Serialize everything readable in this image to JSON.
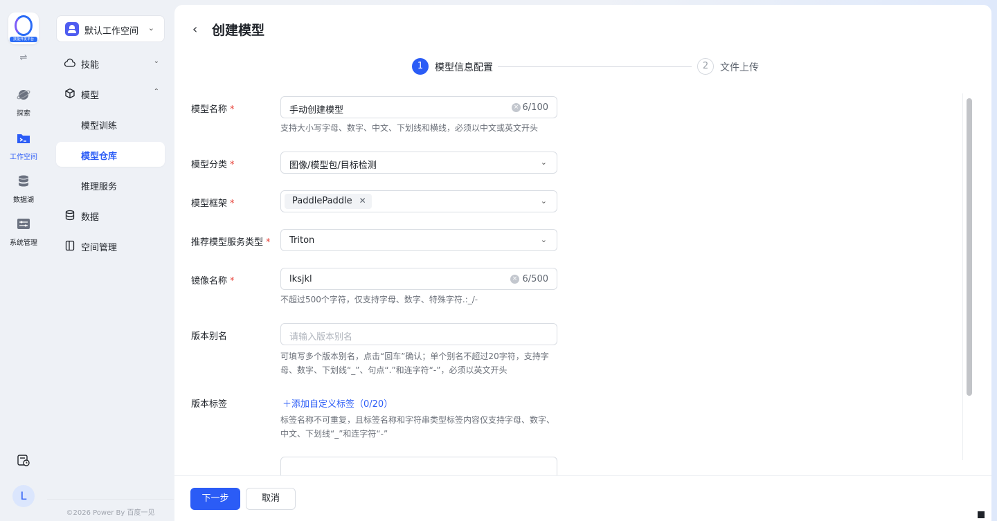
{
  "rail": {
    "logo_caption": "技能开发平台",
    "items": [
      {
        "label": "探索",
        "icon": "planet-icon"
      },
      {
        "label": "工作空间",
        "icon": "terminal-folder-icon"
      },
      {
        "label": "数据湖",
        "icon": "database-icon"
      },
      {
        "label": "系统管理",
        "icon": "server-settings-icon"
      }
    ],
    "avatar": "L"
  },
  "sidebar": {
    "workspace": "默认工作空间",
    "items": [
      {
        "label": "技能"
      },
      {
        "label": "模型"
      },
      {
        "label": "模型训练"
      },
      {
        "label": "模型仓库"
      },
      {
        "label": "推理服务"
      },
      {
        "label": "数据"
      },
      {
        "label": "空间管理"
      }
    ],
    "copyright": "©2026 Power By 百度一见"
  },
  "page": {
    "title": "创建模型",
    "steps": [
      {
        "num": "1",
        "label": "模型信息配置"
      },
      {
        "num": "2",
        "label": "文件上传"
      }
    ]
  },
  "form": {
    "name": {
      "label": "模型名称",
      "value": "手动创建模型",
      "count": "6/100",
      "hint": "支持大小写字母、数字、中文、下划线和横线，必须以中文或英文开头"
    },
    "category": {
      "label": "模型分类",
      "value": "图像/模型包/目标检测"
    },
    "framework": {
      "label": "模型框架",
      "tag": "PaddlePaddle"
    },
    "service_type": {
      "label": "推荐模型服务类型",
      "value": "Triton"
    },
    "image": {
      "label": "镜像名称",
      "value": "lksjkl",
      "count": "6/500",
      "hint": "不超过500个字符，仅支持字母、数字、特殊字符.:_/-"
    },
    "alias": {
      "label": "版本别名",
      "placeholder": "请输入版本别名",
      "hint1": "可填写多个版本别名，点击“回车”确认；单个别名不超过20字符，支持字",
      "hint2": "母、数字、下划线“_”、句点“.”和连字符“-”，必须以英文开头"
    },
    "tags": {
      "label": "版本标签",
      "add": "＋添加自定义标签（0/20）",
      "hint1": "标签名称不可重复，且标签名称和字符串类型标签内容仅支持字母、数字、",
      "hint2": "中文、下划线“_”和连字符“-”"
    }
  },
  "footer": {
    "next": "下一步",
    "cancel": "取消"
  },
  "colors": {
    "accent": "#2b5cf6",
    "required": "#e8453c"
  }
}
